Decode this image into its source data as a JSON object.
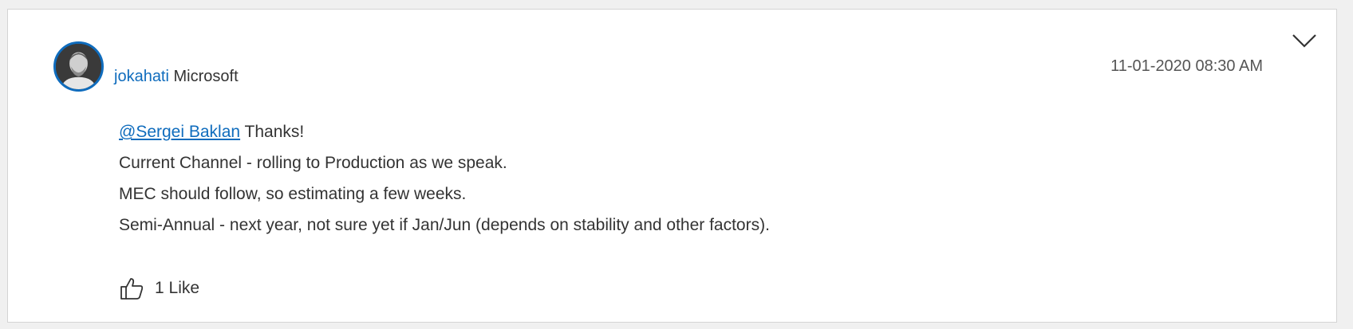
{
  "post": {
    "author": {
      "name": "jokahati",
      "affiliation": "Microsoft"
    },
    "timestamp": "11-01-2020 08:30 AM",
    "body": {
      "mention": "@Sergei Baklan",
      "first_line_rest": " Thanks!",
      "lines": [
        "Current Channel - rolling to Production as we speak.",
        "MEC should follow, so estimating a few weeks.",
        "Semi-Annual - next year, not sure yet if Jan/Jun (depends on stability and other factors)."
      ]
    },
    "likes": {
      "label": "1 Like",
      "icon": "thumbs-up-icon"
    },
    "menu_icon": "chevron-down-icon",
    "colors": {
      "accent": "#0f6cbd",
      "text": "#333333",
      "border": "#d4d4d4",
      "background": "#f0f0f0"
    }
  }
}
